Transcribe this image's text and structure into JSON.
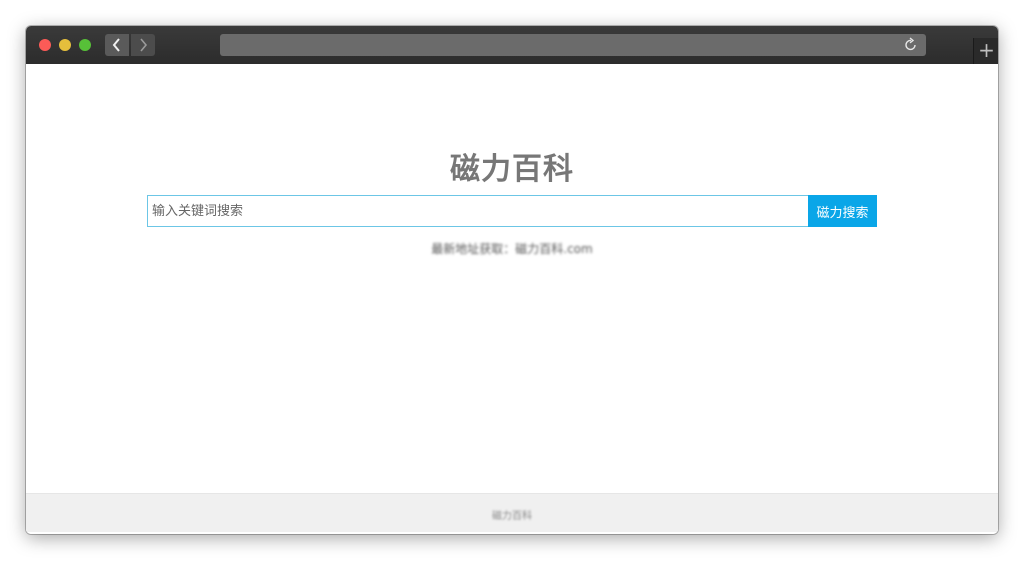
{
  "browser": {
    "back_icon": "chevron-left-icon",
    "forward_icon": "chevron-right-icon",
    "reload_icon": "reload-icon",
    "new_tab_label": "+",
    "colors": {
      "close": "#fc5b57",
      "minimize": "#e5bf3c",
      "maximize": "#57c038"
    }
  },
  "main": {
    "title": "磁力百科",
    "search": {
      "placeholder": "输入关键词搜索",
      "value": "",
      "button_label": "磁力搜索"
    },
    "latest_address": "最新地址获取：磁力百科.com",
    "accent_color": "#0aa6e8"
  },
  "footer": {
    "text": "磁力百科"
  }
}
